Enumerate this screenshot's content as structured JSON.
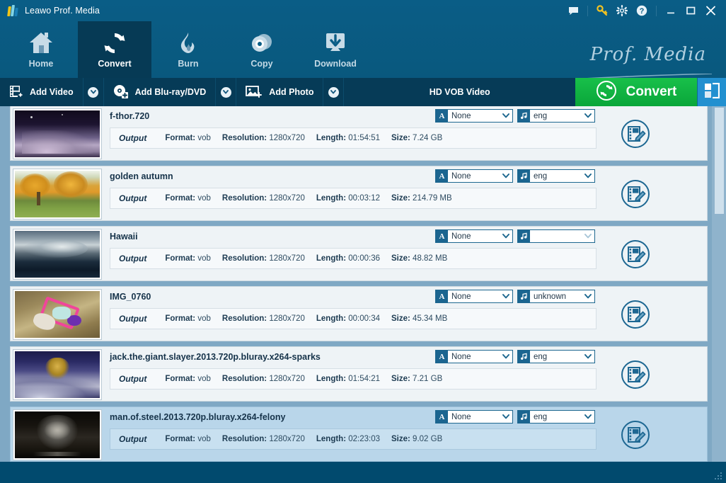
{
  "window": {
    "title": "Leawo Prof. Media",
    "controls": [
      {
        "name": "feedback-icon",
        "label": "feedback"
      },
      {
        "name": "key-icon",
        "label": "register"
      },
      {
        "name": "gear-icon",
        "label": "settings"
      },
      {
        "name": "help-icon",
        "label": "help"
      },
      {
        "name": "minimize-icon",
        "label": "minimize"
      },
      {
        "name": "maximize-icon",
        "label": "maximize"
      },
      {
        "name": "close-icon",
        "label": "close"
      }
    ]
  },
  "nav": {
    "brand": "Prof. Media",
    "items": [
      {
        "label": "Home",
        "icon": "home-icon",
        "active": false
      },
      {
        "label": "Convert",
        "icon": "convert-icon",
        "active": true
      },
      {
        "label": "Burn",
        "icon": "flame-icon",
        "active": false
      },
      {
        "label": "Copy",
        "icon": "disc-icon",
        "active": false
      },
      {
        "label": "Download",
        "icon": "download-icon",
        "active": false
      }
    ]
  },
  "toolbar": {
    "add_video": "Add Video",
    "add_bluray": "Add Blu-ray/DVD",
    "add_photo": "Add Photo",
    "profile": "HD VOB Video",
    "convert": "Convert",
    "panel_toggle_icon": "panel-layout-icon",
    "accent_green": "#12b544",
    "accent_blue": "#2290d0"
  },
  "list": {
    "columns": {
      "output": "Output",
      "format": "Format:",
      "resolution": "Resolution:",
      "length": "Length:",
      "size": "Size:"
    },
    "items": [
      {
        "title": "f-thor.720",
        "format": "vob",
        "resolution": "1280x720",
        "length": "01:54:51",
        "size": "7.24 GB",
        "subtitle": "None",
        "audio": "eng",
        "selected": false,
        "thumb": "night-clouds"
      },
      {
        "title": "golden autumn",
        "format": "vob",
        "resolution": "1280x720",
        "length": "00:03:12",
        "size": "214.79 MB",
        "subtitle": "None",
        "audio": "eng",
        "selected": false,
        "thumb": "autumn-trees"
      },
      {
        "title": "Hawaii",
        "format": "vob",
        "resolution": "1280x720",
        "length": "00:00:36",
        "size": "48.82 MB",
        "subtitle": "None",
        "audio": "",
        "selected": false,
        "thumb": "ocean-wave"
      },
      {
        "title": "IMG_0760",
        "format": "vob",
        "resolution": "1280x720",
        "length": "00:00:34",
        "size": "45.34 MB",
        "subtitle": "None",
        "audio": "unknown",
        "selected": false,
        "thumb": "child-stroller"
      },
      {
        "title": "jack.the.giant.slayer.2013.720p.bluray.x264-sparks",
        "format": "vob",
        "resolution": "1280x720",
        "length": "01:54:21",
        "size": "7.21 GB",
        "subtitle": "None",
        "audio": "eng",
        "selected": false,
        "thumb": "wb-clouds"
      },
      {
        "title": "man.of.steel.2013.720p.bluray.x264-felony",
        "format": "vob",
        "resolution": "1280x720",
        "length": "02:23:03",
        "size": "9.02 GB",
        "subtitle": "None",
        "audio": "eng",
        "selected": true,
        "thumb": "wb-dark"
      }
    ]
  }
}
